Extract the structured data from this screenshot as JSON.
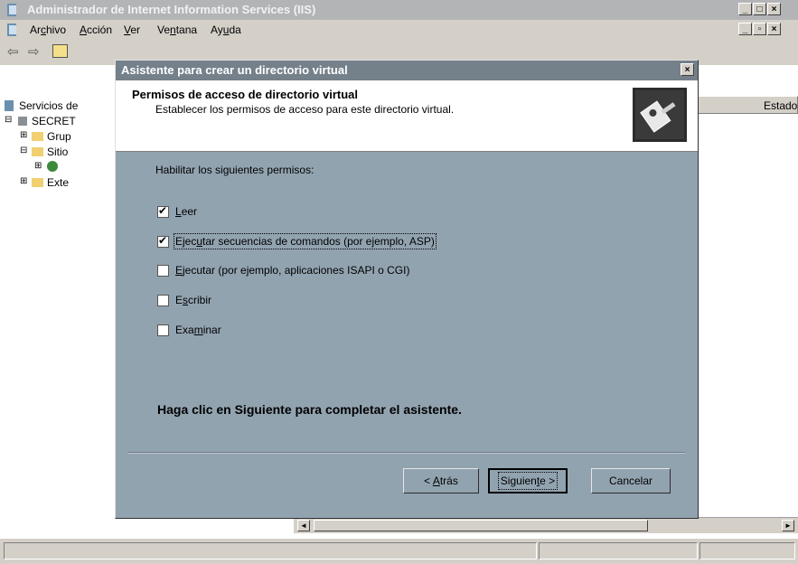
{
  "main_window": {
    "title": "Administrador de Internet Information Services (IIS)",
    "menu": [
      {
        "pre": "Ar",
        "key": "c",
        "post": "hivo"
      },
      {
        "pre": "",
        "key": "A",
        "post": "cción"
      },
      {
        "pre": "",
        "key": "V",
        "post": "er"
      },
      {
        "pre": "Ve",
        "key": "n",
        "post": "tana"
      },
      {
        "pre": "Ay",
        "key": "u",
        "post": "da"
      }
    ],
    "tree": [
      "Servicios de",
      "SECRET",
      "Grup",
      "Sitio",
      "",
      "Exte"
    ],
    "column_header": "Estado"
  },
  "dialog": {
    "title": "Asistente para crear un directorio virtual",
    "header_title": "Permisos de acceso de directorio virtual",
    "header_subtitle": "Establecer los permisos de acceso para este directorio virtual.",
    "instructions": "Habilitar los siguientes permisos:",
    "permissions": [
      {
        "pre": "",
        "key": "L",
        "post": "eer",
        "checked": true
      },
      {
        "pre": "Ejec",
        "key": "u",
        "post": "tar secuencias de comandos (por ejemplo, ASP)",
        "checked": true
      },
      {
        "pre": "",
        "key": "E",
        "post": "jecutar (por ejemplo, aplicaciones ISAPI o CGI)",
        "checked": false
      },
      {
        "pre": "E",
        "key": "s",
        "post": "cribir",
        "checked": false
      },
      {
        "pre": "Exa",
        "key": "m",
        "post": "inar",
        "checked": false
      }
    ],
    "finish_text": "Haga clic en Siguiente para completar el asistente.",
    "buttons": {
      "back": {
        "pre": "< ",
        "key": "A",
        "post": "trás"
      },
      "next": {
        "pre": "Siguien",
        "key": "t",
        "post": "e >"
      },
      "cancel": "Cancelar"
    }
  },
  "colors": {
    "dialog_bg": "#92a3b0",
    "dialog_title_bg": "#74808a",
    "window_chrome": "#d4d0c8"
  }
}
